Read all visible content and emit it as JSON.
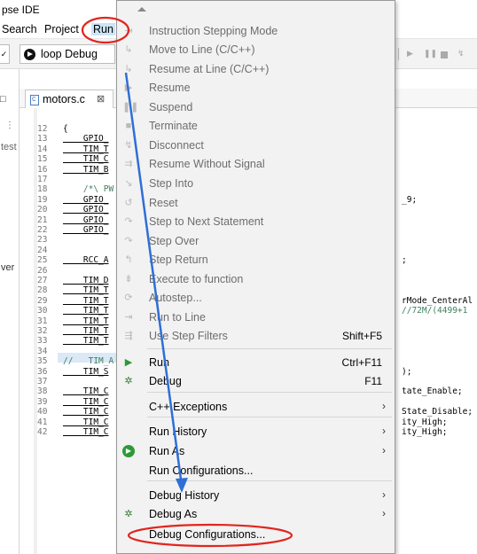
{
  "window": {
    "title": "pse IDE"
  },
  "menubar": {
    "items": [
      "Search",
      "Project",
      "Run"
    ]
  },
  "toolbar": {
    "launch_config": "loop Debug"
  },
  "leftpanel": {
    "snippets": [
      "test",
      "ver"
    ]
  },
  "editor": {
    "tab": {
      "filename": "motors.c",
      "close": "⊠"
    },
    "lines": [
      {
        "n": "12",
        "code": "{"
      },
      {
        "n": "13",
        "code": "    GPIO_"
      },
      {
        "n": "14",
        "code": "    TIM_T"
      },
      {
        "n": "15",
        "code": "    TIM_C"
      },
      {
        "n": "16",
        "code": "    TIM_B"
      },
      {
        "n": "17",
        "code": ""
      },
      {
        "n": "18",
        "code": "    /*\\ PW"
      },
      {
        "n": "19",
        "code": "    GPIO_"
      },
      {
        "n": "20",
        "code": "    GPIO_"
      },
      {
        "n": "21",
        "code": "    GPIO_"
      },
      {
        "n": "22",
        "code": "    GPIO_"
      },
      {
        "n": "23",
        "code": ""
      },
      {
        "n": "24",
        "code": ""
      },
      {
        "n": "25",
        "code": "    RCC_A"
      },
      {
        "n": "26",
        "code": ""
      },
      {
        "n": "27",
        "code": "    TIM_D"
      },
      {
        "n": "28",
        "code": "    TIM_T"
      },
      {
        "n": "29",
        "code": "    TIM_T"
      },
      {
        "n": "30",
        "code": "    TIM_T"
      },
      {
        "n": "31",
        "code": "    TIM_T"
      },
      {
        "n": "32",
        "code": "    TIM_T"
      },
      {
        "n": "33",
        "code": "    TIM_T"
      },
      {
        "n": "34",
        "code": ""
      },
      {
        "n": "35",
        "code": "//   TIM_A"
      },
      {
        "n": "36",
        "code": "    TIM_S"
      },
      {
        "n": "37",
        "code": ""
      },
      {
        "n": "38",
        "code": "    TIM_C"
      },
      {
        "n": "39",
        "code": "    TIM_C"
      },
      {
        "n": "40",
        "code": "    TIM_C"
      },
      {
        "n": "41",
        "code": "    TIM_C"
      },
      {
        "n": "42",
        "code": "    TIM_C"
      }
    ],
    "right_fragments": [
      {
        "line": "19",
        "text": "_9;"
      },
      {
        "line": "25",
        "text": ";"
      },
      {
        "line": "29",
        "text": "rMode_CenterAl"
      },
      {
        "line": "30",
        "text": "//72M/(4499+1"
      },
      {
        "line": "36",
        "text": ");"
      },
      {
        "line": "38",
        "text": "tate_Enable;"
      },
      {
        "line": "40",
        "text": "State_Disable;"
      },
      {
        "line": "41",
        "text": "ity_High;"
      },
      {
        "line": "42",
        "text": "ity_High;"
      }
    ]
  },
  "run_menu": {
    "items": [
      {
        "label": "Instruction Stepping Mode",
        "icon": "instruction-stepping-icon",
        "enabled": false
      },
      {
        "label": "Move to Line (C/C++)",
        "icon": "move-to-line-icon",
        "enabled": false
      },
      {
        "label": "Resume at Line (C/C++)",
        "icon": "resume-at-line-icon",
        "enabled": false
      },
      {
        "label": "Resume",
        "icon": "resume-icon",
        "enabled": false
      },
      {
        "label": "Suspend",
        "icon": "suspend-icon",
        "enabled": false
      },
      {
        "label": "Terminate",
        "icon": "terminate-icon",
        "enabled": false
      },
      {
        "label": "Disconnect",
        "icon": "disconnect-icon",
        "enabled": false
      },
      {
        "label": "Resume Without Signal",
        "icon": "resume-without-signal-icon",
        "enabled": false
      },
      {
        "label": "Step Into",
        "icon": "step-into-icon",
        "enabled": false
      },
      {
        "label": "Reset",
        "icon": "reset-icon",
        "enabled": false
      },
      {
        "label": "Step to Next Statement",
        "icon": "step-next-statement-icon",
        "enabled": false
      },
      {
        "label": "Step Over",
        "icon": "step-over-icon",
        "enabled": false
      },
      {
        "label": "Step Return",
        "icon": "step-return-icon",
        "enabled": false
      },
      {
        "label": "Execute to function",
        "icon": "execute-to-function-icon",
        "enabled": false
      },
      {
        "label": "Autostep...",
        "icon": "autostep-icon",
        "enabled": false
      },
      {
        "label": "Run to Line",
        "icon": "run-to-line-icon",
        "enabled": false
      },
      {
        "label": "Use Step Filters",
        "icon": "step-filters-icon",
        "enabled": false,
        "accel": "Shift+F5"
      },
      {
        "label": "Run",
        "icon": "run-icon",
        "enabled": true,
        "accel": "Ctrl+F11"
      },
      {
        "label": "Debug",
        "icon": "debug-icon",
        "enabled": true,
        "accel": "F11"
      },
      {
        "label": "C++ Exceptions",
        "enabled": true,
        "submenu": true
      },
      {
        "label": "Run History",
        "enabled": true,
        "submenu": true
      },
      {
        "label": "Run As",
        "icon": "run-as-icon",
        "enabled": true,
        "submenu": true
      },
      {
        "label": "Run Configurations...",
        "enabled": true
      },
      {
        "label": "Debug History",
        "enabled": true,
        "submenu": true
      },
      {
        "label": "Debug As",
        "icon": "debug-as-icon",
        "enabled": true,
        "submenu": true
      },
      {
        "label": "Debug Configurations...",
        "enabled": true
      }
    ]
  },
  "colors": {
    "annotation_red": "#e0261e",
    "annotation_blue": "#2e6fd6",
    "menu_bg": "#f2f2f2"
  }
}
